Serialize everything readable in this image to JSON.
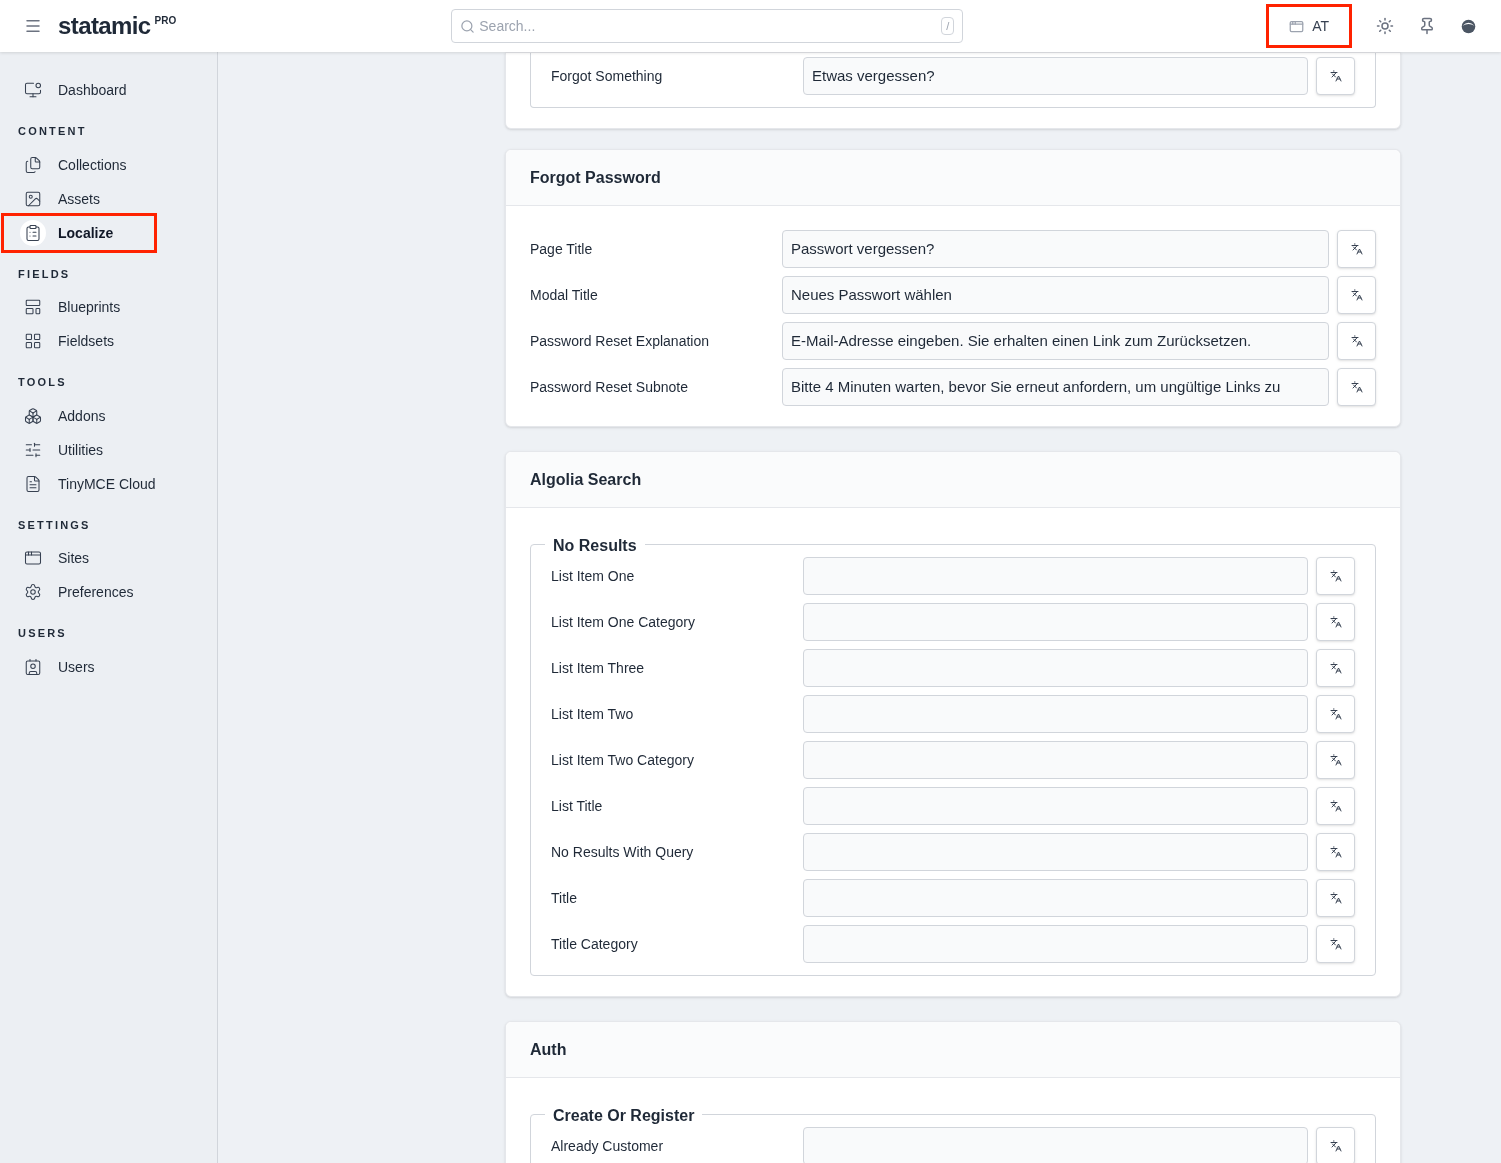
{
  "header": {
    "logo": "statamic",
    "badge": "PRO",
    "search": {
      "placeholder": "Search...",
      "shortcut": "/"
    },
    "site": {
      "label": "AT",
      "highlighted": true
    }
  },
  "sidebar": {
    "sections": [
      {
        "items": [
          {
            "label": "Dashboard",
            "kind": "dashboard",
            "selected": false,
            "highlighted": false
          }
        ]
      },
      {
        "heading": "CONTENT",
        "items": [
          {
            "label": "Collections",
            "kind": "collections",
            "selected": false,
            "highlighted": false
          },
          {
            "label": "Assets",
            "kind": "assets",
            "selected": false,
            "highlighted": false
          },
          {
            "label": "Localize",
            "kind": "localize",
            "selected": true,
            "highlighted": true
          }
        ]
      },
      {
        "heading": "FIELDS",
        "items": [
          {
            "label": "Blueprints",
            "kind": "blueprints",
            "selected": false,
            "highlighted": false
          },
          {
            "label": "Fieldsets",
            "kind": "fieldsets",
            "selected": false,
            "highlighted": false
          }
        ]
      },
      {
        "heading": "TOOLS",
        "items": [
          {
            "label": "Addons",
            "kind": "addons",
            "selected": false,
            "highlighted": false
          },
          {
            "label": "Utilities",
            "kind": "utilities",
            "selected": false,
            "highlighted": false
          },
          {
            "label": "TinyMCE Cloud",
            "kind": "editor",
            "selected": false,
            "highlighted": false
          }
        ]
      },
      {
        "heading": "SETTINGS",
        "items": [
          {
            "label": "Sites",
            "kind": "sites",
            "selected": false,
            "highlighted": false
          },
          {
            "label": "Preferences",
            "kind": "preferences",
            "selected": false,
            "highlighted": false
          }
        ]
      },
      {
        "heading": "USERS",
        "items": [
          {
            "label": "Users",
            "kind": "users",
            "selected": false,
            "highlighted": false
          }
        ]
      }
    ]
  },
  "cards": [
    {
      "groups": [
        {
          "fields": [
            {
              "label": "Forgot Something",
              "value": "Etwas vergessen?"
            }
          ]
        }
      ]
    },
    {
      "title": "Forgot Password",
      "fields": [
        {
          "label": "Page Title",
          "value": "Passwort vergessen?"
        },
        {
          "label": "Modal Title",
          "value": "Neues Passwort wählen"
        },
        {
          "label": "Password Reset Explanation",
          "value": "E-Mail-Adresse eingeben. Sie erhalten einen Link zum Zurücksetzen."
        },
        {
          "label": "Password Reset Subnote",
          "value": "Bitte 4 Minuten warten, bevor Sie erneut anfordern, um ungültige Links zu"
        }
      ]
    },
    {
      "title": "Algolia Search",
      "groups": [
        {
          "legend": "No Results",
          "fields": [
            {
              "label": "List Item One"
            },
            {
              "label": "List Item One Category"
            },
            {
              "label": "List Item Three"
            },
            {
              "label": "List Item Two"
            },
            {
              "label": "List Item Two Category"
            },
            {
              "label": "List Title"
            },
            {
              "label": "No Results With Query"
            },
            {
              "label": "Title"
            },
            {
              "label": "Title Category"
            }
          ]
        }
      ]
    },
    {
      "title": "Auth",
      "groups": [
        {
          "legend": "Create Or Register",
          "fields": [
            {
              "label": "Already Customer"
            }
          ]
        }
      ]
    }
  ]
}
